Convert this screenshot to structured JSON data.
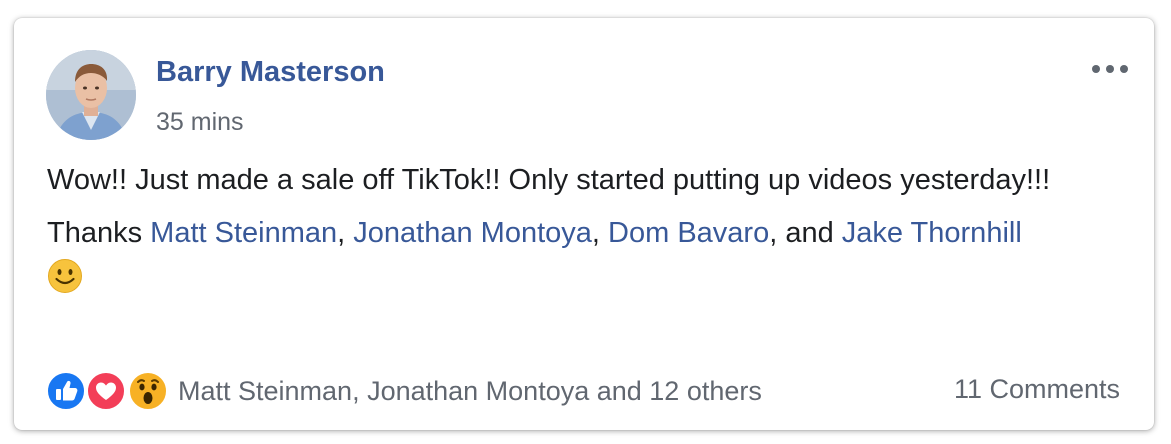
{
  "post": {
    "author": "Barry Masterson",
    "timestamp": "35 mins",
    "line1": "Wow!! Just made a sale off TikTok!! Only started putting up videos yesterday!!!",
    "thanks_prefix": "Thanks ",
    "mentions": [
      "Matt Steinman",
      "Jonathan Montoya",
      "Dom Bavaro",
      "Jake Thornhill"
    ],
    "sep1": ", ",
    "sep2": ", ",
    "sep3": ", and ",
    "emoji": "smile-icon"
  },
  "footer": {
    "reactions": [
      "like-icon",
      "love-icon",
      "wow-icon"
    ],
    "reactors_text": "Matt Steinman, Jonathan Montoya and 12 others",
    "comments": "11 Comments"
  },
  "colors": {
    "link": "#385898",
    "muted": "#616770",
    "text": "#1c1e21",
    "like": "#1877f2",
    "love": "#f33e58",
    "wow": "#f7b125"
  }
}
